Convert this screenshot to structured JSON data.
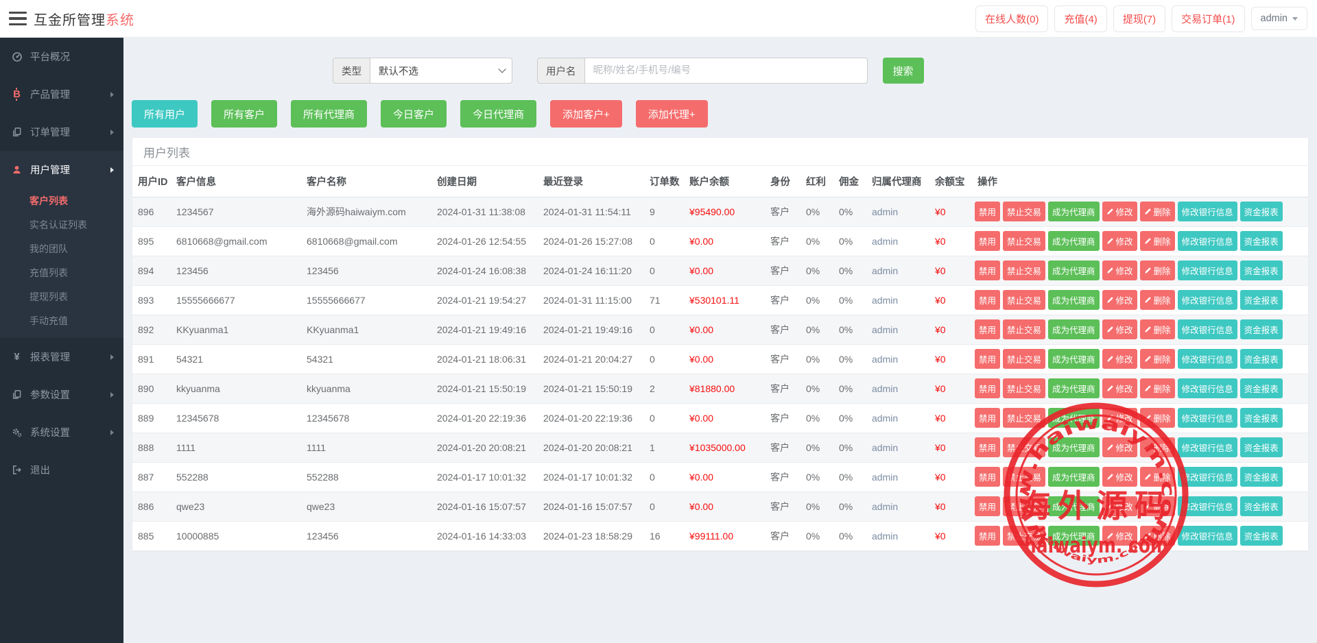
{
  "header": {
    "brand_primary": "互金所管理",
    "brand_accent": "系统",
    "badges": [
      {
        "label": "在线人数(0)"
      },
      {
        "label": "充值(4)"
      },
      {
        "label": "提现(7)"
      },
      {
        "label": "交易订单(1)"
      }
    ],
    "user_menu": "admin"
  },
  "sidebar": {
    "items": [
      {
        "label": "平台概况",
        "icon": "gauge-icon"
      },
      {
        "label": "产品管理",
        "icon": "bitcoin-icon"
      },
      {
        "label": "订单管理",
        "icon": "orders-icon"
      },
      {
        "label": "用户管理",
        "icon": "user-icon"
      },
      {
        "label": "报表管理",
        "icon": "yen-icon"
      },
      {
        "label": "参数设置",
        "icon": "params-icon"
      },
      {
        "label": "系统设置",
        "icon": "gears-icon"
      },
      {
        "label": "退出",
        "icon": "logout-icon"
      }
    ],
    "submenu": [
      {
        "label": "客户列表",
        "active": true
      },
      {
        "label": "实名认证列表",
        "active": false
      },
      {
        "label": "我的团队",
        "active": false
      },
      {
        "label": "充值列表",
        "active": false
      },
      {
        "label": "提现列表",
        "active": false
      },
      {
        "label": "手动充值",
        "active": false
      }
    ]
  },
  "filters": {
    "type_label": "类型",
    "type_value": "默认不选",
    "username_label": "用户名",
    "username_placeholder": "昵称/姓名/手机号/编号",
    "search_label": "搜索"
  },
  "toolbar": {
    "buttons": [
      {
        "label": "所有用户",
        "style": "teal"
      },
      {
        "label": "所有客户",
        "style": "green"
      },
      {
        "label": "所有代理商",
        "style": "green"
      },
      {
        "label": "今日客户",
        "style": "green"
      },
      {
        "label": "今日代理商",
        "style": "green"
      },
      {
        "label": "添加客户+",
        "style": "red"
      },
      {
        "label": "添加代理+",
        "style": "red"
      }
    ]
  },
  "panel": {
    "title": "用户列表"
  },
  "table": {
    "columns": [
      "用户ID",
      "客户信息",
      "客户名称",
      "创建日期",
      "最近登录",
      "订单数",
      "账户余额",
      "身份",
      "红利",
      "佣金",
      "归属代理商",
      "余额宝",
      "操作"
    ],
    "rows": [
      {
        "id": "896",
        "info": "1234567",
        "name": "海外源码haiwaiym.com",
        "created": "2024-01-31 11:38:08",
        "last_login": "2024-01-31 11:54:11",
        "orders": "9",
        "balance": "¥95490.00",
        "role": "客户",
        "bonus": "0%",
        "commission": "0%",
        "agent": "admin",
        "yuebao": "¥0"
      },
      {
        "id": "895",
        "info": "6810668@gmail.com",
        "name": "6810668@gmail.com",
        "created": "2024-01-26 12:54:55",
        "last_login": "2024-01-26 15:27:08",
        "orders": "0",
        "balance": "¥0.00",
        "role": "客户",
        "bonus": "0%",
        "commission": "0%",
        "agent": "admin",
        "yuebao": "¥0"
      },
      {
        "id": "894",
        "info": "123456",
        "name": "123456",
        "created": "2024-01-24 16:08:38",
        "last_login": "2024-01-24 16:11:20",
        "orders": "0",
        "balance": "¥0.00",
        "role": "客户",
        "bonus": "0%",
        "commission": "0%",
        "agent": "admin",
        "yuebao": "¥0"
      },
      {
        "id": "893",
        "info": "15555666677",
        "name": "15555666677",
        "created": "2024-01-21 19:54:27",
        "last_login": "2024-01-31 11:15:00",
        "orders": "71",
        "balance": "¥530101.11",
        "role": "客户",
        "bonus": "0%",
        "commission": "0%",
        "agent": "admin",
        "yuebao": "¥0"
      },
      {
        "id": "892",
        "info": "KKyuanma1",
        "name": "KKyuanma1",
        "created": "2024-01-21 19:49:16",
        "last_login": "2024-01-21 19:49:16",
        "orders": "0",
        "balance": "¥0.00",
        "role": "客户",
        "bonus": "0%",
        "commission": "0%",
        "agent": "admin",
        "yuebao": "¥0"
      },
      {
        "id": "891",
        "info": "54321",
        "name": "54321",
        "created": "2024-01-21 18:06:31",
        "last_login": "2024-01-21 20:04:27",
        "orders": "0",
        "balance": "¥0.00",
        "role": "客户",
        "bonus": "0%",
        "commission": "0%",
        "agent": "admin",
        "yuebao": "¥0"
      },
      {
        "id": "890",
        "info": "kkyuanma",
        "name": "kkyuanma",
        "created": "2024-01-21 15:50:19",
        "last_login": "2024-01-21 15:50:19",
        "orders": "2",
        "balance": "¥81880.00",
        "role": "客户",
        "bonus": "0%",
        "commission": "0%",
        "agent": "admin",
        "yuebao": "¥0"
      },
      {
        "id": "889",
        "info": "12345678",
        "name": "12345678",
        "created": "2024-01-20 22:19:36",
        "last_login": "2024-01-20 22:19:36",
        "orders": "0",
        "balance": "¥0.00",
        "role": "客户",
        "bonus": "0%",
        "commission": "0%",
        "agent": "admin",
        "yuebao": "¥0"
      },
      {
        "id": "888",
        "info": "1111",
        "name": "1111",
        "created": "2024-01-20 20:08:21",
        "last_login": "2024-01-20 20:08:21",
        "orders": "1",
        "balance": "¥1035000.00",
        "role": "客户",
        "bonus": "0%",
        "commission": "0%",
        "agent": "admin",
        "yuebao": "¥0"
      },
      {
        "id": "887",
        "info": "552288",
        "name": "552288",
        "created": "2024-01-17 10:01:32",
        "last_login": "2024-01-17 10:01:32",
        "orders": "0",
        "balance": "¥0.00",
        "role": "客户",
        "bonus": "0%",
        "commission": "0%",
        "agent": "admin",
        "yuebao": "¥0"
      },
      {
        "id": "886",
        "info": "qwe23",
        "name": "qwe23",
        "created": "2024-01-16 15:07:57",
        "last_login": "2024-01-16 15:07:57",
        "orders": "0",
        "balance": "¥0.00",
        "role": "客户",
        "bonus": "0%",
        "commission": "0%",
        "agent": "admin",
        "yuebao": "¥0"
      },
      {
        "id": "885",
        "info": "10000885",
        "name": "123456",
        "created": "2024-01-16 14:33:03",
        "last_login": "2024-01-23 18:58:29",
        "orders": "16",
        "balance": "¥99111.00",
        "role": "客户",
        "bonus": "0%",
        "commission": "0%",
        "agent": "admin",
        "yuebao": "¥0"
      }
    ],
    "op_buttons": [
      {
        "label": "禁用",
        "style": "red",
        "name": "disable-button",
        "icon": null
      },
      {
        "label": "禁止交易",
        "style": "red",
        "name": "ban-trade-button",
        "icon": null
      },
      {
        "label": "成为代理商",
        "style": "green",
        "name": "make-agent-button",
        "icon": null
      },
      {
        "label": "修改",
        "style": "red",
        "name": "edit-button",
        "icon": "pencil-icon"
      },
      {
        "label": "删除",
        "style": "red",
        "name": "delete-button",
        "icon": "pencil-icon"
      },
      {
        "label": "修改银行信息",
        "style": "teal",
        "name": "edit-bank-button",
        "icon": null
      },
      {
        "label": "资金报表",
        "style": "teal",
        "name": "funds-report-button",
        "icon": null
      }
    ]
  },
  "watermark": {
    "top_arc": "www.haiwaiym.com",
    "center": "海外源码",
    "subtitle": "haiwaiym. com",
    "bottom_arc": "haiwaiym.com"
  },
  "colors": {
    "accent_red": "#f56c6c",
    "green": "#5cbf58",
    "teal": "#3ec8c2",
    "balance_red": "#f60d0d",
    "stamp_red": "#e8232a",
    "sidebar_bg": "#222d37"
  }
}
